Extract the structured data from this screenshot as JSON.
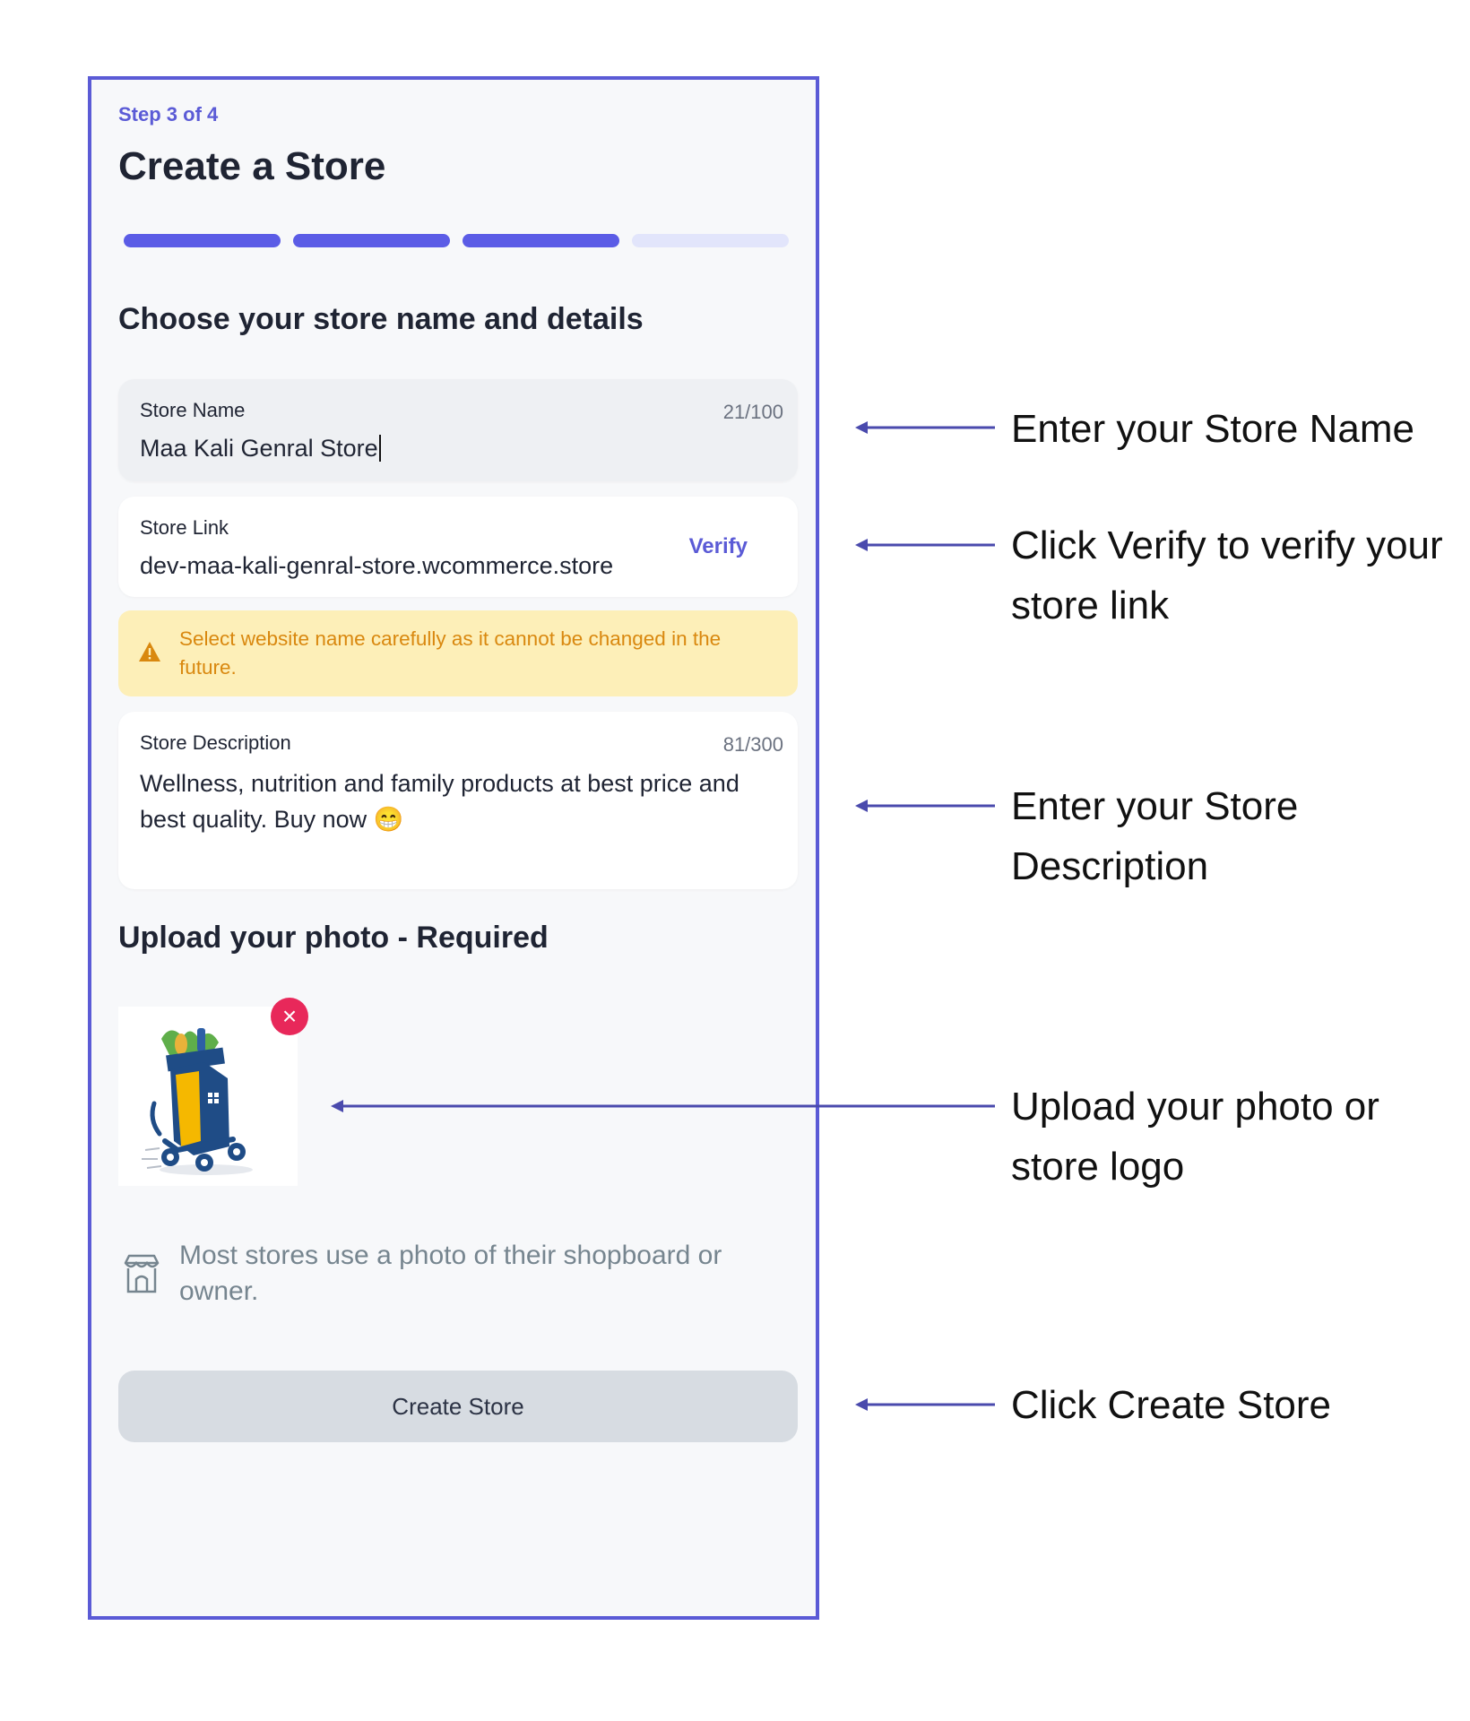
{
  "wizard": {
    "step": "Step 3 of 4",
    "title": "Create a Store",
    "progress": {
      "total_steps": 4,
      "completed_steps": 3
    },
    "subtitle": "Choose your store name and details"
  },
  "store_name": {
    "label": "Store Name",
    "counter": "21/100",
    "value": "Maa Kali Genral Store"
  },
  "store_link": {
    "label": "Store Link",
    "value": "dev-maa-kali-genral-store.wcommerce.store",
    "verify_label": "Verify"
  },
  "warning": {
    "text": "Select website name carefully as it cannot be changed in the future.",
    "icon": "warning-triangle-icon"
  },
  "store_description": {
    "label": "Store Description",
    "counter": "81/300",
    "value": "Wellness, nutrition and family products at best price and best quality. Buy now 😁"
  },
  "upload": {
    "title": "Upload your photo - Required",
    "remove_icon": "close-icon",
    "hint": "Most stores use a photo of their shopboard or owner.",
    "hint_icon": "storefront-icon"
  },
  "create_button": {
    "label": "Create Store"
  },
  "annotations": {
    "store_name": "Enter your Store Name",
    "verify": "Click Verify to verify your store link",
    "description": "Enter your Store Description",
    "upload": "Upload your photo or store logo",
    "create": "Click Create Store"
  },
  "colors": {
    "accent": "#5b5bd6",
    "progress_active": "#5b5ce6",
    "progress_inactive": "#e2e5fb",
    "warning_bg": "#fdefb8",
    "warning_text": "#d9880f",
    "remove": "#e8285a"
  }
}
